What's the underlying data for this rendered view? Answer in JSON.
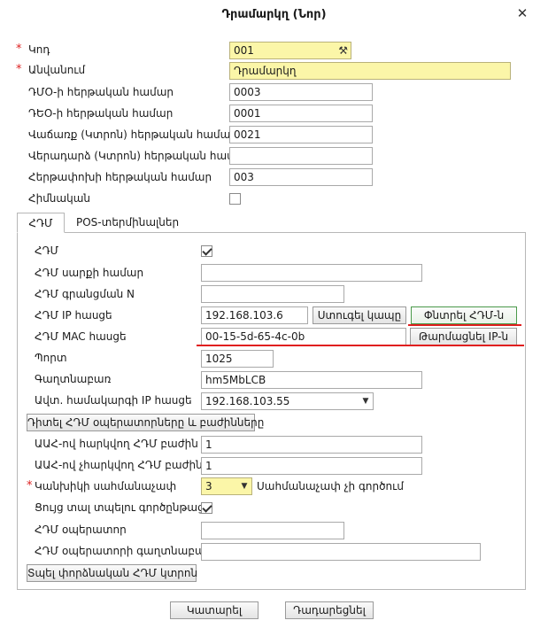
{
  "window": {
    "title": "Դրամարկղ (Նոր)"
  },
  "fields": {
    "code": {
      "label": "Կոդ",
      "value": "001"
    },
    "name": {
      "label": "Անվանում",
      "value": "Դրամարկղ"
    },
    "dmo_serial": {
      "label": "ԴՄՕ-ի հերթական համար",
      "value": "0003"
    },
    "deo_serial": {
      "label": "ԴԵՕ-ի հերթական համար",
      "value": "0001"
    },
    "sale_check_serial": {
      "label": "Վաճառք (Կտրոն) հերթական համար",
      "value": "0021"
    },
    "return_check_serial": {
      "label": "Վերադարձ (Կտրոն) հերթական համար",
      "value": ""
    },
    "settlement_serial": {
      "label": "Հերթափոխի հերթական համար",
      "value": "003"
    },
    "is_main": {
      "label": "Հիմնական",
      "checked": false
    }
  },
  "tabs": [
    {
      "label": "ՀԴՄ",
      "active": true
    },
    {
      "label": "POS-տերմինալներ",
      "active": false
    }
  ],
  "hdm": {
    "enabled": {
      "label": "ՀԴՄ",
      "checked": true
    },
    "serial": {
      "label": "ՀԴՄ սարքի համար",
      "value": ""
    },
    "reg_number": {
      "label": "ՀԴՄ գրանցման N",
      "value": ""
    },
    "ip": {
      "label": "ՀԴՄ IP հասցե",
      "value": "192.168.103.6"
    },
    "check_connection_btn": "Ստուգել կապը",
    "find_hdm_btn": "Փնտրել ՀԴՄ-ն",
    "mac": {
      "label": "ՀԴՄ MAC հասցե",
      "value": "00-15-5d-65-4c-0b"
    },
    "refresh_ip_btn": "Թարմացնել IP-ն",
    "port": {
      "label": "Պորտ",
      "value": "1025"
    },
    "password": {
      "label": "Գաղտնաբառ",
      "value": "hm5MbLCB"
    },
    "local_ip": {
      "label": "Ավտ. համակարգի IP հասցե",
      "value": "192.168.103.55"
    },
    "view_operators_btn": "Դիտել ՀԴՄ օպերատորները և բաժինները",
    "vat_dept": {
      "label": "ԱԱՀ-ով հարկվող ՀԴՄ բաժին",
      "value": "1"
    },
    "non_vat_dept": {
      "label": "ԱԱՀ-ով չհարկվող ՀԴՄ բաժին",
      "value": "1"
    },
    "cash_limit": {
      "label": "Կանխիկի սահմանաչափ",
      "value": "3",
      "hint": "Սահմանաչափ չի գործում"
    },
    "show_print_process": {
      "label": "Ցույց տալ տպելու գործընթացը",
      "checked": true
    },
    "operator": {
      "label": "ՀԴՄ օպերատոր",
      "value": ""
    },
    "operator_password": {
      "label": "ՀԴՄ օպերատորի գաղտնաբառ",
      "value": ""
    },
    "print_duplicate_btn": "Տպել փորձնական ՀԴՄ կտրոն"
  },
  "footer": {
    "ok_btn": "Կատարել",
    "cancel_btn": "Դադարեցնել"
  },
  "colors": {
    "required_star": "#dd2222",
    "highlight_field": "#fbf6a8",
    "annotation_line": "#e01f1f",
    "primary_button_border": "#4a9a4a"
  }
}
